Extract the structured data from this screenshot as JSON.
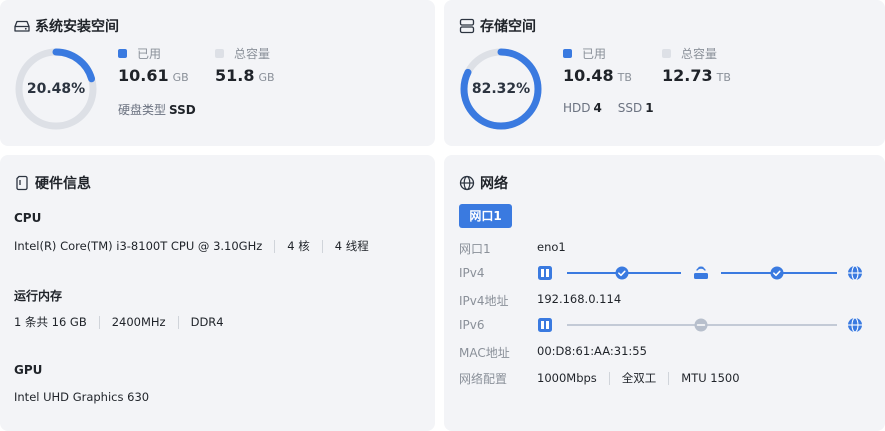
{
  "system_space": {
    "title": "系统安装空间",
    "percent_label": "20.48%",
    "percent": 20.48,
    "used_label": "已用",
    "used_value": "10.61",
    "used_unit": "GB",
    "total_label": "总容量",
    "total_value": "51.8",
    "total_unit": "GB",
    "disk_type_label": "硬盘类型",
    "disk_type_value": "SSD"
  },
  "storage_space": {
    "title": "存储空间",
    "percent_label": "82.32%",
    "percent": 82.32,
    "used_label": "已用",
    "used_value": "10.48",
    "used_unit": "TB",
    "total_label": "总容量",
    "total_value": "12.73",
    "total_unit": "TB",
    "hdd_label": "HDD",
    "hdd_count": "4",
    "ssd_label": "SSD",
    "ssd_count": "1"
  },
  "hardware": {
    "title": "硬件信息",
    "cpu_heading": "CPU",
    "cpu_model": "Intel(R) Core(TM) i3-8100T CPU @ 3.10GHz",
    "cpu_cores": "4 核",
    "cpu_threads": "4 线程",
    "ram_heading": "运行内存",
    "ram_modules": "1 条共 16 GB",
    "ram_speed": "2400MHz",
    "ram_type": "DDR4",
    "gpu_heading": "GPU",
    "gpu_model": "Intel UHD Graphics 630"
  },
  "network": {
    "title": "网络",
    "tab": "网口1",
    "rows": [
      {
        "label": "网口1",
        "value": "eno1"
      },
      {
        "label": "IPv4",
        "value": ""
      },
      {
        "label": "IPv4地址",
        "value": "192.168.0.114"
      },
      {
        "label": "IPv6",
        "value": ""
      },
      {
        "label": "MAC地址",
        "value": "00:D8:61:AA:31:55"
      },
      {
        "label": "网络配置",
        "value": ""
      }
    ],
    "config_speed": "1000Mbps",
    "config_duplex": "全双工",
    "config_mtu": "MTU 1500",
    "ipv4_status": "connected",
    "ipv6_status": "disconnected"
  },
  "colors": {
    "accent": "#3a7ae0",
    "ring_track": "#dde0e6",
    "card_bg": "#f3f4f7",
    "muted": "#8a9099",
    "inactive": "#b7bfcc"
  },
  "icons": [
    "disk-icon",
    "storage-icon",
    "hardware-icon",
    "globe-icon",
    "nas-device-icon",
    "router-icon",
    "check-circle-icon",
    "minus-circle-icon"
  ]
}
